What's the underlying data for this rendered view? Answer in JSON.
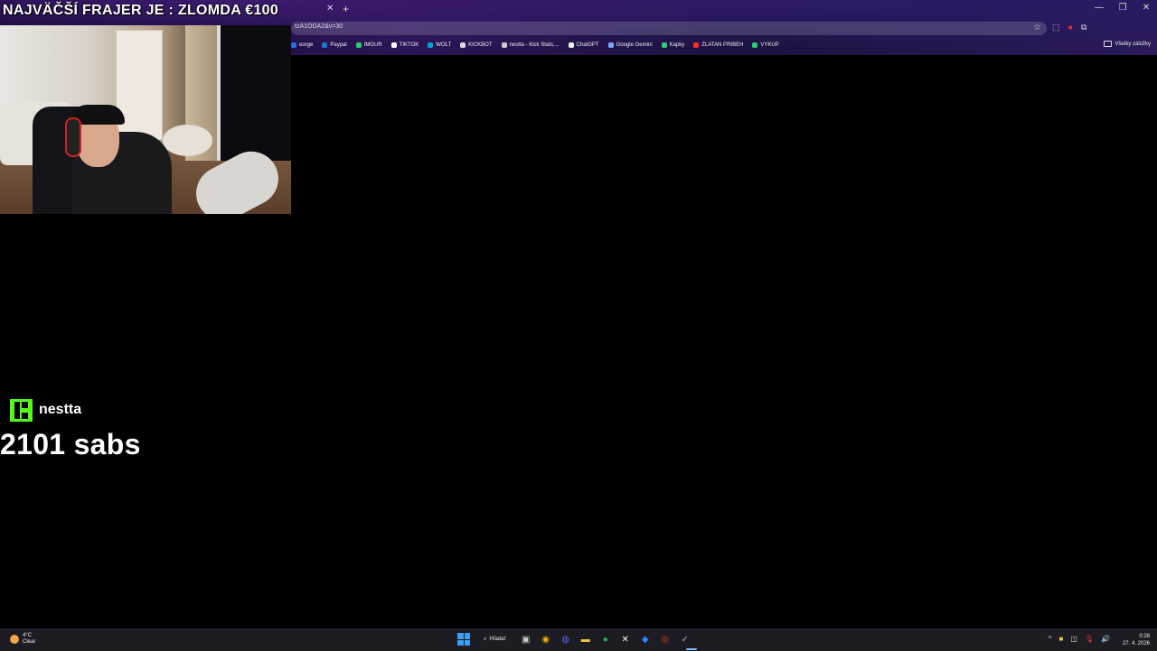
{
  "stream": {
    "title": "NAJVÄČŠÍ FRAJER JE : ZLOMDA  €100",
    "channel": "nestta",
    "subs_text": "2101 sabs"
  },
  "browser": {
    "url": "tzA1ODA2&v=30",
    "bookmarks": [
      {
        "label": "eorge",
        "icon_color": "#2d6fe0"
      },
      {
        "label": "Paypal",
        "icon_color": "#1f77d0"
      },
      {
        "label": "IMGUR",
        "icon_color": "#2ecc71"
      },
      {
        "label": "TIKTOK",
        "icon_color": "#ffffff"
      },
      {
        "label": "WOLT",
        "icon_color": "#00a3e0"
      },
      {
        "label": "KICKBOT",
        "icon_color": "#dddddd"
      },
      {
        "label": "nestta - Kick Stats,...",
        "icon_color": "#cccccc"
      },
      {
        "label": "ChatGPT",
        "icon_color": "#eeeeee"
      },
      {
        "label": "Google Gemini",
        "icon_color": "#7aa7ff"
      },
      {
        "label": "Kapky",
        "icon_color": "#2ecc71"
      },
      {
        "label": "ZLATAN PRIBEH",
        "icon_color": "#ff2b2b"
      },
      {
        "label": "VYKUP",
        "icon_color": "#2ecc71"
      }
    ],
    "all_bookmarks_label": "Všetky záložky"
  },
  "taskbar": {
    "weather_temp": "4°C",
    "weather_desc": "Clear",
    "search_label": "Hľadať",
    "time": "0:28",
    "date": "27. 4. 2026"
  },
  "colors": {
    "kick_green": "#53fc18",
    "taskbar_bg": "#1c1c22"
  }
}
